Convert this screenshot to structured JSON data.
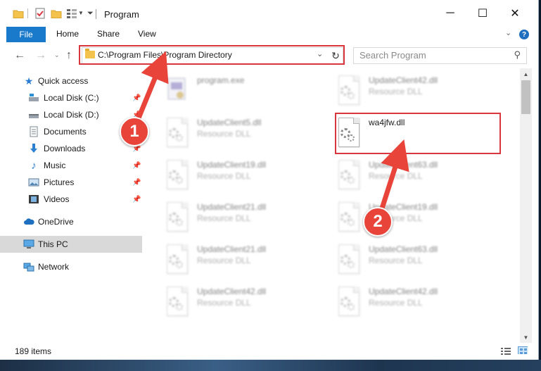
{
  "window": {
    "title": "Program",
    "tabs": {
      "file": "File",
      "home": "Home",
      "share": "Share",
      "view": "View"
    },
    "controls": {
      "minimize": "─",
      "maximize": "☐",
      "close": "✕"
    }
  },
  "navigation": {
    "address": "C:\\Program Files\\Program Directory",
    "search_placeholder": "Search Program"
  },
  "sidebar": {
    "quick_access": "Quick access",
    "items": [
      {
        "label": "Local Disk (C:)",
        "icon": "drive-icon",
        "pinned": true
      },
      {
        "label": "Local Disk (D:)",
        "icon": "drive-icon",
        "pinned": true
      },
      {
        "label": "Documents",
        "icon": "documents-icon",
        "pinned": true
      },
      {
        "label": "Downloads",
        "icon": "downloads-icon",
        "pinned": true
      },
      {
        "label": "Music",
        "icon": "music-icon",
        "pinned": true
      },
      {
        "label": "Pictures",
        "icon": "pictures-icon",
        "pinned": true
      },
      {
        "label": "Videos",
        "icon": "videos-icon",
        "pinned": true
      }
    ],
    "onedrive": "OneDrive",
    "this_pc": "This PC",
    "network": "Network"
  },
  "files": [
    {
      "name": "program.exe",
      "desc": "",
      "type": "exe",
      "blurred": true
    },
    {
      "name": "UpdateClient42.dll",
      "desc": "Resource DLL",
      "type": "dll",
      "blurred": true
    },
    {
      "name": "UpdateClient5.dll",
      "desc": "Resource DLL",
      "type": "dll",
      "blurred": true
    },
    {
      "name": "wa4jfw.dll",
      "desc": "",
      "type": "dll",
      "blurred": false
    },
    {
      "name": "UpdateClient19.dll",
      "desc": "Resource DLL",
      "type": "dll",
      "blurred": true
    },
    {
      "name": "UpdateClient63.dll",
      "desc": "Resource DLL",
      "type": "dll",
      "blurred": true
    },
    {
      "name": "UpdateClient21.dll",
      "desc": "Resource DLL",
      "type": "dll",
      "blurred": true
    },
    {
      "name": "UpdateClient19.dll",
      "desc": "Resource DLL",
      "type": "dll",
      "blurred": true
    },
    {
      "name": "UpdateClient21.dll",
      "desc": "Resource DLL",
      "type": "dll",
      "blurred": true
    },
    {
      "name": "UpdateClient63.dll",
      "desc": "Resource DLL",
      "type": "dll",
      "blurred": true
    },
    {
      "name": "UpdateClient42.dll",
      "desc": "Resource DLL",
      "type": "dll",
      "blurred": true
    },
    {
      "name": "UpdateClient42.dll",
      "desc": "Resource DLL",
      "type": "dll",
      "blurred": true
    }
  ],
  "status": {
    "item_count": "189 items"
  },
  "annotations": {
    "step1": "1",
    "step2": "2"
  },
  "colors": {
    "accent": "#1979ca",
    "highlight": "#d9363e",
    "badge": "#e8443a"
  }
}
